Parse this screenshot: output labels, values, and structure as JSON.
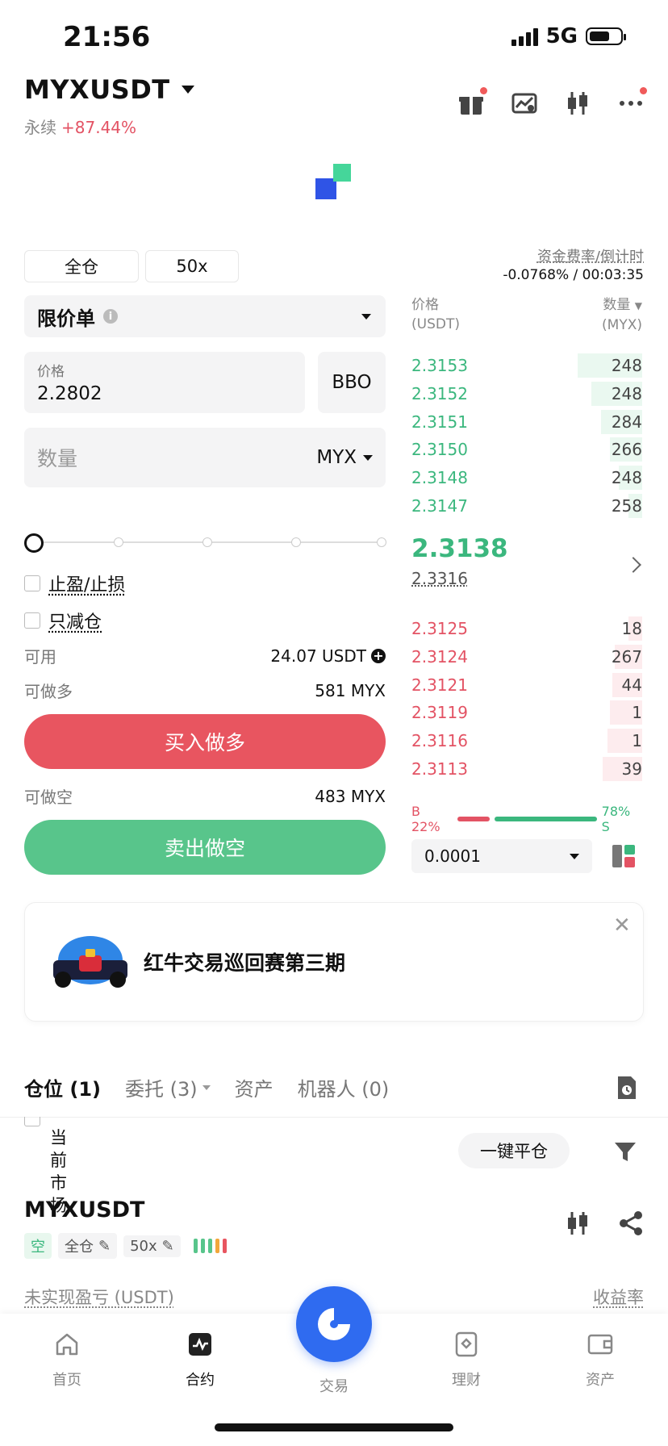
{
  "status_bar": {
    "time": "21:56",
    "network": "5G"
  },
  "header": {
    "pair": "MYXUSDT",
    "contract_type": "永续",
    "change": "+87.44%"
  },
  "order_form": {
    "margin_mode": "全仓",
    "leverage": "50x",
    "order_type": "限价单",
    "price_label": "价格",
    "price_value": "2.2802",
    "bbo_label": "BBO",
    "qty_placeholder": "数量",
    "qty_unit": "MYX",
    "slider_percent": 0,
    "tp_sl_label": "止盈/止损",
    "reduce_only_label": "只减仓",
    "available_label": "可用",
    "available_value": "24.07 USDT",
    "max_long_label": "可做多",
    "max_long_value": "581 MYX",
    "buy_button": "买入做多",
    "max_short_label": "可做空",
    "max_short_value": "483 MYX",
    "sell_button": "卖出做空"
  },
  "funding": {
    "label": "资金费率/倒计时",
    "value": "-0.0768% / 00:03:35"
  },
  "orderbook": {
    "price_header": "价格",
    "price_unit": "(USDT)",
    "qty_header": "数量",
    "qty_unit": "(MYX)",
    "asks": [
      {
        "price": "2.3153",
        "qty": "248",
        "depth": 0.28
      },
      {
        "price": "2.3152",
        "qty": "248",
        "depth": 0.22
      },
      {
        "price": "2.3151",
        "qty": "284",
        "depth": 0.18
      },
      {
        "price": "2.3150",
        "qty": "266",
        "depth": 0.14
      },
      {
        "price": "2.3148",
        "qty": "248",
        "depth": 0.1
      },
      {
        "price": "2.3147",
        "qty": "258",
        "depth": 0.06
      }
    ],
    "last_price": "2.3138",
    "mark_price": "2.3316",
    "bids": [
      {
        "price": "2.3125",
        "qty": "18",
        "depth": 0.06
      },
      {
        "price": "2.3124",
        "qty": "267",
        "depth": 0.12
      },
      {
        "price": "2.3121",
        "qty": "44",
        "depth": 0.13
      },
      {
        "price": "2.3119",
        "qty": "1",
        "depth": 0.14
      },
      {
        "price": "2.3116",
        "qty": "1",
        "depth": 0.15
      },
      {
        "price": "2.3113",
        "qty": "39",
        "depth": 0.17
      }
    ],
    "buy_ratio": "B 22%",
    "sell_ratio": "78% S",
    "precision": "0.0001"
  },
  "banner": {
    "text": "红牛交易巡回赛第三期"
  },
  "positions_tabs": [
    {
      "label": "仓位 (1)",
      "active": true
    },
    {
      "label": "委托 (3)",
      "active": false
    },
    {
      "label": "资产",
      "active": false
    },
    {
      "label": "机器人 (0)",
      "active": false
    }
  ],
  "positions": {
    "current_market_label": "当前市场",
    "close_all": "一键平仓",
    "pair": "MYXUSDT",
    "side_tag": "空",
    "margin_tag": "全仓",
    "leverage_tag": "50x",
    "unrealized_label": "未实现盈亏 (USDT)",
    "yield_label": "收益率"
  },
  "bottom_nav": [
    {
      "label": "首页",
      "active": false
    },
    {
      "label": "合约",
      "active": true
    },
    {
      "label": "交易",
      "active": false
    },
    {
      "label": "理财",
      "active": false
    },
    {
      "label": "资产",
      "active": false
    }
  ],
  "colors": {
    "buy": "#e85560",
    "sell": "#58c58b",
    "ask_text": "#3bb77e",
    "bid_text": "#e35364",
    "accent": "#2f6bf0"
  }
}
